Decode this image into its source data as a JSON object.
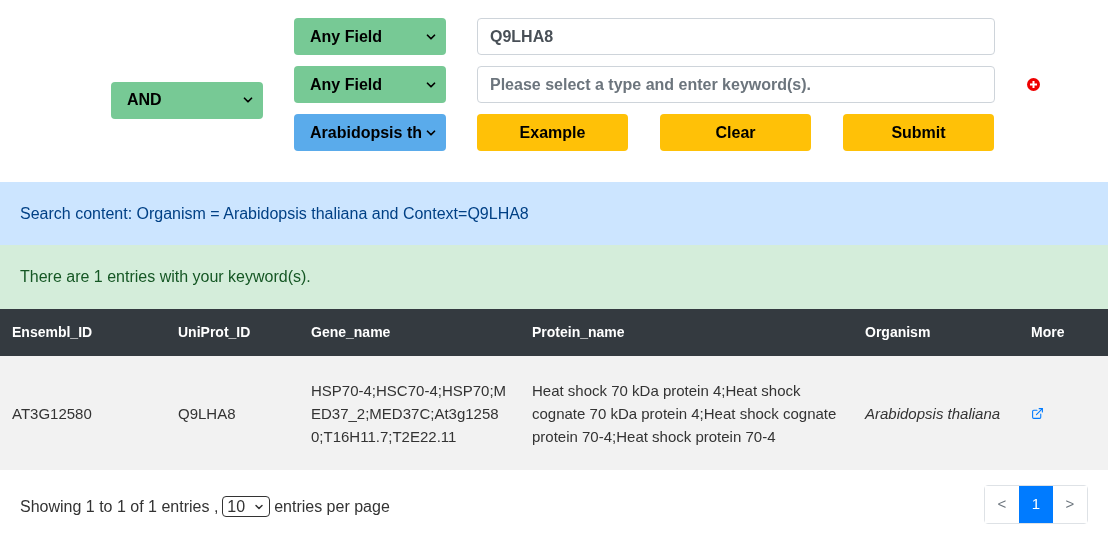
{
  "search_form": {
    "operator": "AND",
    "rows": [
      {
        "field": "Any Field",
        "value": "Q9LHA8",
        "placeholder": ""
      },
      {
        "field": "Any Field",
        "value": "",
        "placeholder": "Please select a type and enter keyword(s)."
      }
    ],
    "organism": "Arabidopsis th",
    "buttons": [
      "Example",
      "Clear",
      "Submit"
    ]
  },
  "search_summary": "Search content: Organism = Arabidopsis thaliana and Context=Q9LHA8",
  "result_count": "There are 1 entries with your keyword(s).",
  "table": {
    "columns": [
      "Ensembl_ID",
      "UniProt_ID",
      "Gene_name",
      "Protein_name",
      "Organism",
      "More"
    ],
    "rows": [
      {
        "cells": [
          "AT3G12580",
          "Q9LHA8",
          "HSP70-4;HSC70-4;HSP70;MED37_2;MED37C;At3g12580;T16H11.7;T2E22.11",
          "Heat shock 70 kDa protein 4;Heat shock cognate 70 kDa protein 4;Heat shock cognate protein 70-4;Heat shock protein 70-4",
          "Arabidopsis thaliana"
        ]
      }
    ]
  },
  "footer": {
    "showing": "Showing 1 to 1 of 1 entries ,",
    "page_size": "10",
    "per_page": "entries per page"
  },
  "pagination": [
    {
      "label": "<",
      "selected": false
    },
    {
      "label": "1",
      "selected": true
    },
    {
      "label": ">",
      "selected": false
    }
  ]
}
